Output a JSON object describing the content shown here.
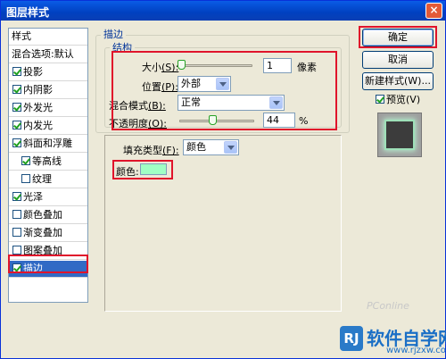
{
  "window": {
    "title": "图层样式",
    "close_glyph": "×"
  },
  "styles_panel": {
    "header": "样式",
    "blend_options": "混合选项:默认",
    "items": [
      {
        "label": "投影",
        "checked": true
      },
      {
        "label": "内阴影",
        "checked": true
      },
      {
        "label": "外发光",
        "checked": true
      },
      {
        "label": "内发光",
        "checked": true
      },
      {
        "label": "斜面和浮雕",
        "checked": true
      },
      {
        "label": "等高线",
        "checked": true
      },
      {
        "label": "纹理",
        "checked": false
      },
      {
        "label": "光泽",
        "checked": true
      },
      {
        "label": "颜色叠加",
        "checked": false
      },
      {
        "label": "渐变叠加",
        "checked": false
      },
      {
        "label": "图案叠加",
        "checked": false
      },
      {
        "label": "描边",
        "checked": true,
        "selected": true
      }
    ]
  },
  "stroke": {
    "section_title": "描边",
    "structure_title": "结构",
    "size_label": "大小",
    "size_key": "(S):",
    "size_value": "1",
    "size_unit": "像素",
    "position_label": "位置",
    "position_key": "(P):",
    "position_value": "外部",
    "blend_label": "混合模式",
    "blend_key": "(B):",
    "blend_value": "正常",
    "opacity_label": "不透明度",
    "opacity_key": "(O):",
    "opacity_value": "44",
    "opacity_unit": "%",
    "opacity_fraction": 0.44,
    "fill_type_label": "填充类型",
    "fill_type_key": "(F):",
    "fill_type_value": "颜色",
    "color_label": "颜色:",
    "color_value": "#a0ffc4"
  },
  "buttons": {
    "ok": "确定",
    "cancel": "取消",
    "new_style": "新建样式(W)...",
    "preview_label": "预览(V)",
    "preview_checked": true
  },
  "watermarks": {
    "pconline": "PConline",
    "brand_name": "软件自学网",
    "brand_logo": "RJ",
    "brand_url": "www.rjzxw.com"
  },
  "colors": {
    "highlight": "#e0142b",
    "accent": "#316ac5",
    "stroke_color": "#a0ffc4"
  }
}
